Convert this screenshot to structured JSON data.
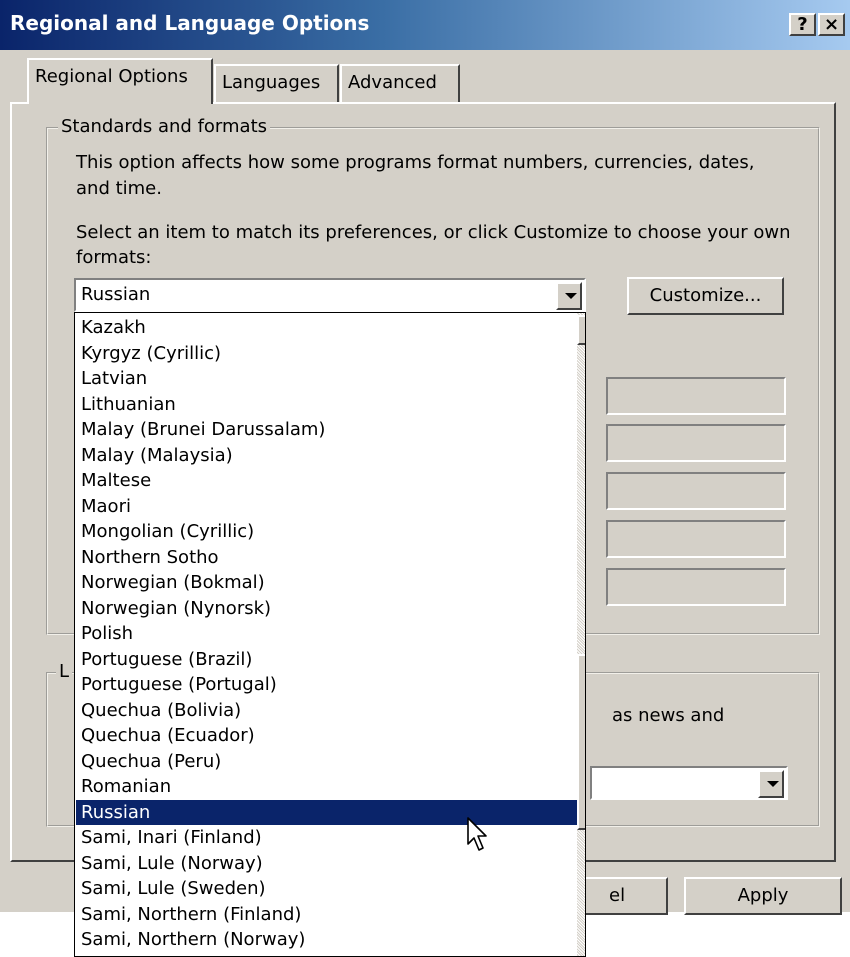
{
  "window": {
    "title": "Regional and Language Options",
    "help_button": "?",
    "close_button": "×"
  },
  "tabs": [
    "Regional Options",
    "Languages",
    "Advanced"
  ],
  "standards": {
    "group_label": "Standards and formats",
    "description1": "This option affects how some programs format numbers, currencies, dates,",
    "description1b": "and time.",
    "description2": "Select an item to match its preferences, or click Customize to choose your own",
    "description2b": "formats:",
    "selected_format": "Russian",
    "customize_button": "Customize..."
  },
  "location": {
    "group_label_fragment": "L",
    "text_fragment": "as news and"
  },
  "buttons": {
    "cancel_fragment": "el",
    "apply": "Apply"
  },
  "dropdown_list": {
    "items": [
      "Kazakh",
      "Kyrgyz (Cyrillic)",
      "Latvian",
      "Lithuanian",
      "Malay (Brunei Darussalam)",
      "Malay (Malaysia)",
      "Maltese",
      "Maori",
      "Mongolian (Cyrillic)",
      "Northern Sotho",
      "Norwegian (Bokmal)",
      "Norwegian (Nynorsk)",
      "Polish",
      "Portuguese (Brazil)",
      "Portuguese (Portugal)",
      "Quechua (Bolivia)",
      "Quechua (Ecuador)",
      "Quechua (Peru)",
      "Romanian",
      "Russian",
      "Sami, Inari (Finland)",
      "Sami, Lule (Norway)",
      "Sami, Lule (Sweden)",
      "Sami, Northern (Finland)",
      "Sami, Northern (Norway)"
    ],
    "selected": "Russian"
  },
  "colors": {
    "dialog_face": "#d4d0c8",
    "title_start": "#0a246a",
    "title_end": "#a6caf0",
    "selection": "#0a246a"
  }
}
